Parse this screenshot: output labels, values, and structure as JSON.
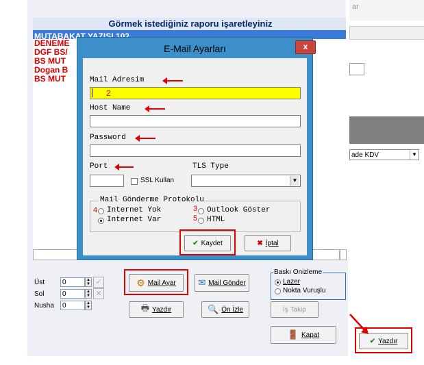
{
  "background": {
    "report_header": "Görmek istediğiniz raporu işaretleyiniz",
    "reports": [
      "MUTABAKAT YAZISI 102",
      "DENEME",
      "DGF BS/",
      "BS MUT",
      "Dogan B",
      "BS MUT"
    ],
    "right_top_text": "ar",
    "kdv_combo": "ade KDV"
  },
  "dialog": {
    "title": "E-Mail Ayarları",
    "close_label": "x",
    "mail_label": "Mail Adresim",
    "mail_value": "",
    "host_label": "Host Name",
    "host_value": "",
    "password_label": "Password",
    "password_value": "",
    "port_label": "Port",
    "port_value": "",
    "ssl_label": "SSL Kullan",
    "tls_label": "TLS Type",
    "tls_value": "",
    "protocol_group_label": "Mail Gönderme Protokolu",
    "radio_internet_yok": "Internet Yok",
    "radio_internet_var": "Internet Var",
    "radio_outlook": "Outlook Göster",
    "radio_html": "HTML",
    "save_label": "Kaydet",
    "cancel_label": "İptal",
    "annotation_numbers": {
      "mail": "2",
      "internet_yok": "4",
      "outlook": "3",
      "html": "5"
    }
  },
  "bottom": {
    "ust_label": "Üst",
    "ust_value": "0",
    "sol_label": "Sol",
    "sol_value": "0",
    "nusha_label": "Nusha",
    "nusha_value": "0",
    "mail_ayar_label": "Mail Ayar",
    "mail_gonder_label": "Mail Gönder",
    "yazdir_label": "Yazdır",
    "on_izle_label": "Ön İzle",
    "is_takip_label": "İş Takip",
    "kapat_label": "Kapat",
    "preview_group_label": "Baskı Onizleme",
    "lazer_label": "Lazer",
    "nokta_label": "Nokta Vuruşlu",
    "yazdir_right_label": "Yazdır"
  },
  "colors": {
    "accent_red": "#e00000",
    "dialog_border": "#3d8fc9",
    "highlight_yellow": "#ffff00",
    "report_red": "#e00000"
  }
}
